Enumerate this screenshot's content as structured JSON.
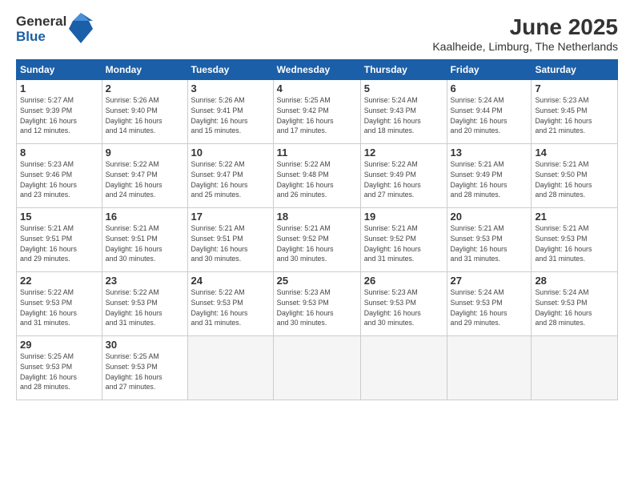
{
  "logo": {
    "general": "General",
    "blue": "Blue"
  },
  "title": "June 2025",
  "subtitle": "Kaalheide, Limburg, The Netherlands",
  "weekdays": [
    "Sunday",
    "Monday",
    "Tuesday",
    "Wednesday",
    "Thursday",
    "Friday",
    "Saturday"
  ],
  "weeks": [
    [
      {
        "day": "1",
        "sunrise": "5:27 AM",
        "sunset": "9:39 PM",
        "daylight": "16 hours and 12 minutes."
      },
      {
        "day": "2",
        "sunrise": "5:26 AM",
        "sunset": "9:40 PM",
        "daylight": "16 hours and 14 minutes."
      },
      {
        "day": "3",
        "sunrise": "5:26 AM",
        "sunset": "9:41 PM",
        "daylight": "16 hours and 15 minutes."
      },
      {
        "day": "4",
        "sunrise": "5:25 AM",
        "sunset": "9:42 PM",
        "daylight": "16 hours and 17 minutes."
      },
      {
        "day": "5",
        "sunrise": "5:24 AM",
        "sunset": "9:43 PM",
        "daylight": "16 hours and 18 minutes."
      },
      {
        "day": "6",
        "sunrise": "5:24 AM",
        "sunset": "9:44 PM",
        "daylight": "16 hours and 20 minutes."
      },
      {
        "day": "7",
        "sunrise": "5:23 AM",
        "sunset": "9:45 PM",
        "daylight": "16 hours and 21 minutes."
      }
    ],
    [
      {
        "day": "8",
        "sunrise": "5:23 AM",
        "sunset": "9:46 PM",
        "daylight": "16 hours and 23 minutes."
      },
      {
        "day": "9",
        "sunrise": "5:22 AM",
        "sunset": "9:47 PM",
        "daylight": "16 hours and 24 minutes."
      },
      {
        "day": "10",
        "sunrise": "5:22 AM",
        "sunset": "9:47 PM",
        "daylight": "16 hours and 25 minutes."
      },
      {
        "day": "11",
        "sunrise": "5:22 AM",
        "sunset": "9:48 PM",
        "daylight": "16 hours and 26 minutes."
      },
      {
        "day": "12",
        "sunrise": "5:22 AM",
        "sunset": "9:49 PM",
        "daylight": "16 hours and 27 minutes."
      },
      {
        "day": "13",
        "sunrise": "5:21 AM",
        "sunset": "9:49 PM",
        "daylight": "16 hours and 28 minutes."
      },
      {
        "day": "14",
        "sunrise": "5:21 AM",
        "sunset": "9:50 PM",
        "daylight": "16 hours and 28 minutes."
      }
    ],
    [
      {
        "day": "15",
        "sunrise": "5:21 AM",
        "sunset": "9:51 PM",
        "daylight": "16 hours and 29 minutes."
      },
      {
        "day": "16",
        "sunrise": "5:21 AM",
        "sunset": "9:51 PM",
        "daylight": "16 hours and 30 minutes."
      },
      {
        "day": "17",
        "sunrise": "5:21 AM",
        "sunset": "9:51 PM",
        "daylight": "16 hours and 30 minutes."
      },
      {
        "day": "18",
        "sunrise": "5:21 AM",
        "sunset": "9:52 PM",
        "daylight": "16 hours and 30 minutes."
      },
      {
        "day": "19",
        "sunrise": "5:21 AM",
        "sunset": "9:52 PM",
        "daylight": "16 hours and 31 minutes."
      },
      {
        "day": "20",
        "sunrise": "5:21 AM",
        "sunset": "9:53 PM",
        "daylight": "16 hours and 31 minutes."
      },
      {
        "day": "21",
        "sunrise": "5:21 AM",
        "sunset": "9:53 PM",
        "daylight": "16 hours and 31 minutes."
      }
    ],
    [
      {
        "day": "22",
        "sunrise": "5:22 AM",
        "sunset": "9:53 PM",
        "daylight": "16 hours and 31 minutes."
      },
      {
        "day": "23",
        "sunrise": "5:22 AM",
        "sunset": "9:53 PM",
        "daylight": "16 hours and 31 minutes."
      },
      {
        "day": "24",
        "sunrise": "5:22 AM",
        "sunset": "9:53 PM",
        "daylight": "16 hours and 31 minutes."
      },
      {
        "day": "25",
        "sunrise": "5:23 AM",
        "sunset": "9:53 PM",
        "daylight": "16 hours and 30 minutes."
      },
      {
        "day": "26",
        "sunrise": "5:23 AM",
        "sunset": "9:53 PM",
        "daylight": "16 hours and 30 minutes."
      },
      {
        "day": "27",
        "sunrise": "5:24 AM",
        "sunset": "9:53 PM",
        "daylight": "16 hours and 29 minutes."
      },
      {
        "day": "28",
        "sunrise": "5:24 AM",
        "sunset": "9:53 PM",
        "daylight": "16 hours and 28 minutes."
      }
    ],
    [
      {
        "day": "29",
        "sunrise": "5:25 AM",
        "sunset": "9:53 PM",
        "daylight": "16 hours and 28 minutes."
      },
      {
        "day": "30",
        "sunrise": "5:25 AM",
        "sunset": "9:53 PM",
        "daylight": "16 hours and 27 minutes."
      },
      null,
      null,
      null,
      null,
      null
    ]
  ]
}
